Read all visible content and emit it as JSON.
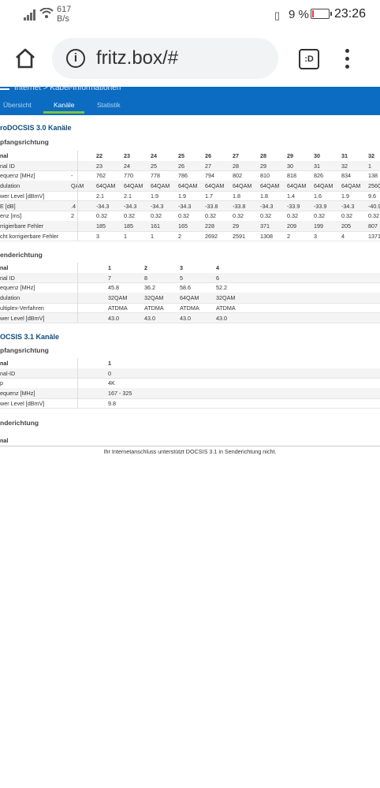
{
  "status_bar": {
    "speed_value": "617",
    "speed_unit": "B/s",
    "battery": "9 %",
    "time": "23:26"
  },
  "browser": {
    "url": "fritz.box/#",
    "tab_button": ":D"
  },
  "header": {
    "breadcrumb": "Internet > Kabel-Informationen",
    "tabs": [
      "Übersicht",
      "Kanäle",
      "Statistik"
    ],
    "active_tab": "Kanäle"
  },
  "docsis30": {
    "title": "roDOCSIS 3.0 Kanäle",
    "downstream": {
      "title": "pfangsrichtung",
      "rows": [
        {
          "label": "nal",
          "values": [
            "22",
            "23",
            "24",
            "25",
            "26",
            "27",
            "28",
            "29",
            "30",
            "31",
            "32"
          ]
        },
        {
          "label": "nal ID",
          "values": [
            "23",
            "24",
            "25",
            "26",
            "27",
            "28",
            "29",
            "30",
            "31",
            "32",
            "1"
          ]
        },
        {
          "label": "equenz [MHz]",
          "values": [
            "762",
            "770",
            "778",
            "786",
            "794",
            "802",
            "810",
            "818",
            "826",
            "834",
            "138"
          ]
        },
        {
          "label": "dulation",
          "values": [
            "64QAM",
            "64QAM",
            "64QAM",
            "64QAM",
            "64QAM",
            "64QAM",
            "64QAM",
            "64QAM",
            "64QAM",
            "64QAM",
            "256Q"
          ]
        },
        {
          "label": "wer Level [dBmV]",
          "values": [
            "2.1",
            "2.1",
            "1.9",
            "1.9",
            "1.7",
            "1.8",
            "1.8",
            "1.4",
            "1.6",
            "1.9",
            "9.6"
          ]
        },
        {
          "label": "E [dB]",
          "values": [
            "-34.3",
            "-34.3",
            "-34.3",
            "-34.3",
            "-33.8",
            "-33.8",
            "-34.3",
            "-33.9",
            "-33.9",
            "-34.3",
            "-40.9"
          ]
        },
        {
          "label": "enz [ms]",
          "values": [
            "0.32",
            "0.32",
            "0.32",
            "0.32",
            "0.32",
            "0.32",
            "0.32",
            "0.32",
            "0.32",
            "0.32",
            "0.32"
          ]
        },
        {
          "label": "rrigierbare Fehler",
          "values": [
            "185",
            "185",
            "161",
            "165",
            "228",
            "29",
            "371",
            "209",
            "199",
            "205",
            "807"
          ]
        },
        {
          "label": "cht korrigierbare Fehler",
          "values": [
            "3",
            "1",
            "1",
            "2",
            "2692",
            "2591",
            "1308",
            "2",
            "3",
            "4",
            "1371"
          ]
        }
      ],
      "left_fragments": {
        "dulation": "QAM",
        "E [dB]": ".4",
        "enz [ms]": "2",
        "equenz [MHz]": "-"
      }
    },
    "upstream": {
      "title": "enderichtung",
      "rows": [
        {
          "label": "nal",
          "values": [
            "1",
            "2",
            "3",
            "4"
          ]
        },
        {
          "label": "nal ID",
          "values": [
            "7",
            "8",
            "5",
            "6"
          ]
        },
        {
          "label": "equenz [MHz]",
          "values": [
            "45.8",
            "36.2",
            "58.6",
            "52.2"
          ]
        },
        {
          "label": "dulation",
          "values": [
            "32QAM",
            "32QAM",
            "64QAM",
            "32QAM"
          ]
        },
        {
          "label": "ultiplex-Verfahren",
          "values": [
            "ATDMA",
            "ATDMA",
            "ATDMA",
            "ATDMA"
          ]
        },
        {
          "label": "wer Level [dBmV]",
          "values": [
            "43.0",
            "43.0",
            "43.0",
            "43.0"
          ]
        }
      ]
    }
  },
  "docsis31": {
    "title": "OCSIS 3.1 Kanäle",
    "downstream": {
      "title": "pfangsrichtung",
      "rows": [
        {
          "label": "nal",
          "values": [
            "1"
          ]
        },
        {
          "label": "nal-ID",
          "values": [
            "0"
          ]
        },
        {
          "label": "p",
          "values": [
            "4K"
          ]
        },
        {
          "label": "equenz [MHz]",
          "values": [
            "167 - 325"
          ]
        },
        {
          "label": "wer Level [dBmV]",
          "values": [
            "9.8"
          ]
        }
      ]
    },
    "upstream": {
      "title": "nderichtung",
      "header": "nal",
      "note": "Ihr Internetanschluss unterstützt DOCSIS 3.1 in Senderichtung nicht."
    }
  }
}
